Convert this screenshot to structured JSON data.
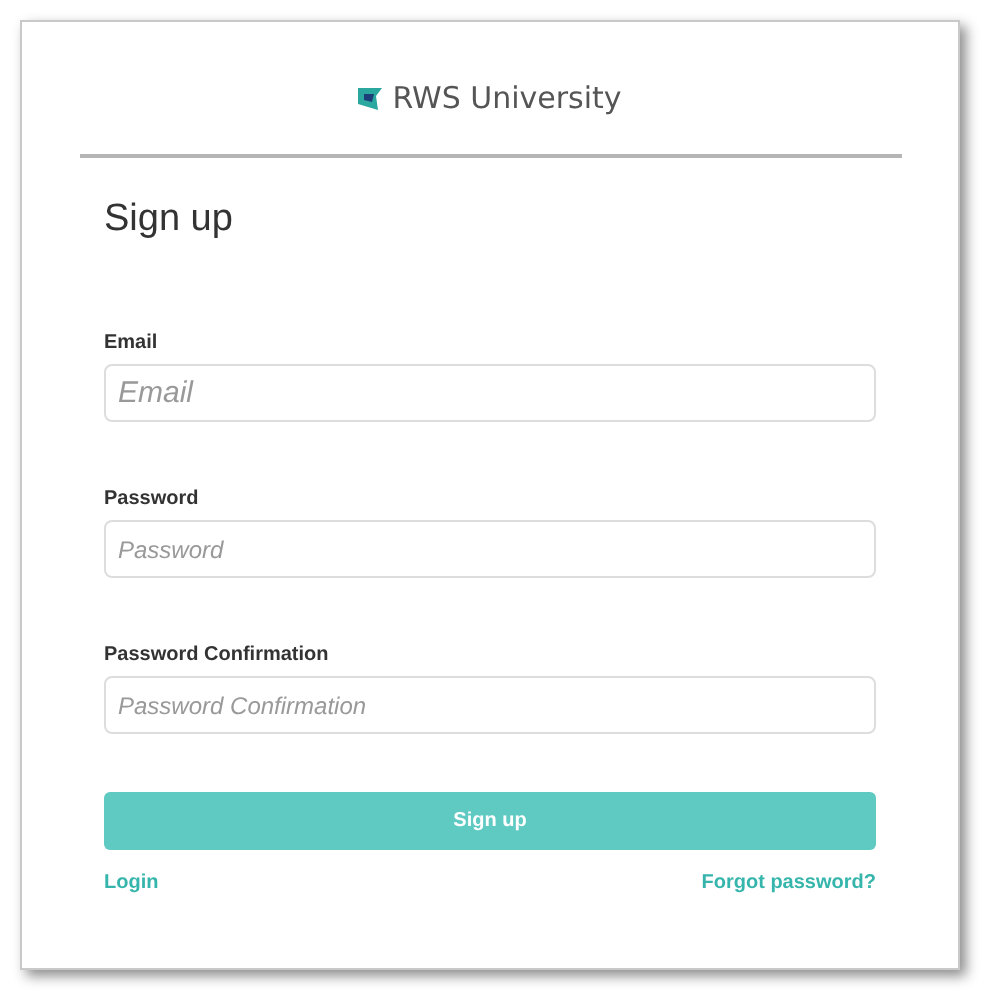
{
  "logo": {
    "text": "RWS University"
  },
  "title": "Sign up",
  "fields": [
    {
      "label": "Email",
      "placeholder": "Email",
      "kind": "large"
    },
    {
      "label": "Password",
      "placeholder": "Password",
      "kind": "normal"
    },
    {
      "label": "Password Confirmation",
      "placeholder": "Password Confirmation",
      "kind": "normal"
    }
  ],
  "submit": "Sign up",
  "links": [
    "Login",
    "Forgot password?"
  ]
}
